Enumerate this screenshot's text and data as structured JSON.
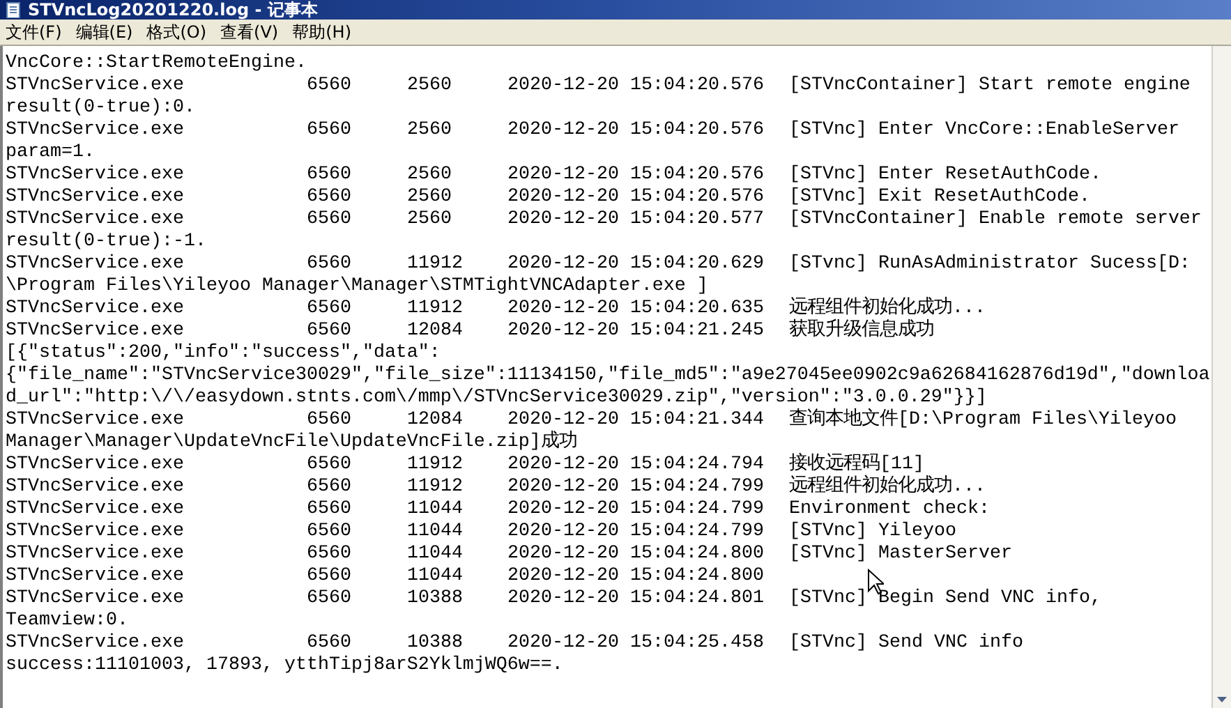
{
  "window": {
    "title": "STVncLog20201220.log - 记事本"
  },
  "menu": [
    "文件(F)",
    "编辑(E)",
    "格式(O)",
    "查看(V)",
    "帮助(H)"
  ],
  "lines": [
    {
      "kind": "text",
      "text": "VncCore::StartRemoteEngine."
    },
    {
      "kind": "entry",
      "process": "STVncService.exe",
      "pid": "6560",
      "tid": "2560",
      "time": "2020-12-20 15:04:20.576",
      "message": "[STVncContainer] Start remote engine"
    },
    {
      "kind": "text",
      "text": "result(0-true):0."
    },
    {
      "kind": "entry",
      "process": "STVncService.exe",
      "pid": "6560",
      "tid": "2560",
      "time": "2020-12-20 15:04:20.576",
      "message": "[STVnc] Enter VncCore::EnableServer"
    },
    {
      "kind": "text",
      "text": "param=1."
    },
    {
      "kind": "entry",
      "process": "STVncService.exe",
      "pid": "6560",
      "tid": "2560",
      "time": "2020-12-20 15:04:20.576",
      "message": "[STVnc] Enter ResetAuthCode."
    },
    {
      "kind": "entry",
      "process": "STVncService.exe",
      "pid": "6560",
      "tid": "2560",
      "time": "2020-12-20 15:04:20.576",
      "message": "[STVnc] Exit ResetAuthCode."
    },
    {
      "kind": "entry",
      "process": "STVncService.exe",
      "pid": "6560",
      "tid": "2560",
      "time": "2020-12-20 15:04:20.577",
      "message": "[STVncContainer] Enable remote server"
    },
    {
      "kind": "text",
      "text": "result(0-true):-1."
    },
    {
      "kind": "entry",
      "process": "STVncService.exe",
      "pid": "6560",
      "tid": "11912",
      "time": "2020-12-20 15:04:20.629",
      "message": "[STvnc] RunAsAdministrator Sucess[D:"
    },
    {
      "kind": "text",
      "text": "\\Program Files\\Yileyoo Manager\\Manager\\STMTightVNCAdapter.exe ]"
    },
    {
      "kind": "entry",
      "process": "STVncService.exe",
      "pid": "6560",
      "tid": "11912",
      "time": "2020-12-20 15:04:20.635",
      "message": "远程组件初始化成功..."
    },
    {
      "kind": "entry",
      "process": "STVncService.exe",
      "pid": "6560",
      "tid": "12084",
      "time": "2020-12-20 15:04:21.245",
      "message": "获取升级信息成功"
    },
    {
      "kind": "text",
      "text": "[{\"status\":200,\"info\":\"success\",\"data\":"
    },
    {
      "kind": "text",
      "text": "{\"file_name\":\"STVncService30029\",\"file_size\":11134150,\"file_md5\":\"a9e27045ee0902c9a62684162876d19d\",\"downloa"
    },
    {
      "kind": "text",
      "text": "d_url\":\"http:\\/\\/easydown.stnts.com\\/mmp\\/STVncService30029.zip\",\"version\":\"3.0.0.29\"}}]"
    },
    {
      "kind": "entry",
      "process": "STVncService.exe",
      "pid": "6560",
      "tid": "12084",
      "time": "2020-12-20 15:04:21.344",
      "message": "查询本地文件[D:\\Program Files\\Yileyoo"
    },
    {
      "kind": "text",
      "text": "Manager\\Manager\\UpdateVncFile\\UpdateVncFile.zip]成功"
    },
    {
      "kind": "entry",
      "process": "STVncService.exe",
      "pid": "6560",
      "tid": "11912",
      "time": "2020-12-20 15:04:24.794",
      "message": "接收远程码[11]"
    },
    {
      "kind": "entry",
      "process": "STVncService.exe",
      "pid": "6560",
      "tid": "11912",
      "time": "2020-12-20 15:04:24.799",
      "message": "远程组件初始化成功..."
    },
    {
      "kind": "entry",
      "process": "STVncService.exe",
      "pid": "6560",
      "tid": "11044",
      "time": "2020-12-20 15:04:24.799",
      "message": "Environment check:"
    },
    {
      "kind": "entry",
      "process": "STVncService.exe",
      "pid": "6560",
      "tid": "11044",
      "time": "2020-12-20 15:04:24.799",
      "message": "[STVnc] Yileyoo"
    },
    {
      "kind": "entry",
      "process": "STVncService.exe",
      "pid": "6560",
      "tid": "11044",
      "time": "2020-12-20 15:04:24.800",
      "message": "[STVnc] MasterServer"
    },
    {
      "kind": "entry",
      "process": "STVncService.exe",
      "pid": "6560",
      "tid": "11044",
      "time": "2020-12-20 15:04:24.800"
    },
    {
      "kind": "entry",
      "process": "STVncService.exe",
      "pid": "6560",
      "tid": "10388",
      "time": "2020-12-20 15:04:24.801",
      "message": "[STVnc] Begin Send VNC info,"
    },
    {
      "kind": "text",
      "text": "Teamview:0."
    },
    {
      "kind": "entry",
      "process": "STVncService.exe",
      "pid": "6560",
      "tid": "10388",
      "time": "2020-12-20 15:04:25.458",
      "message": "[STVnc] Send VNC info"
    },
    {
      "kind": "text",
      "text": "success:11101003, 17893, ytthTipj8arS2YklmjWQ6w==."
    }
  ]
}
